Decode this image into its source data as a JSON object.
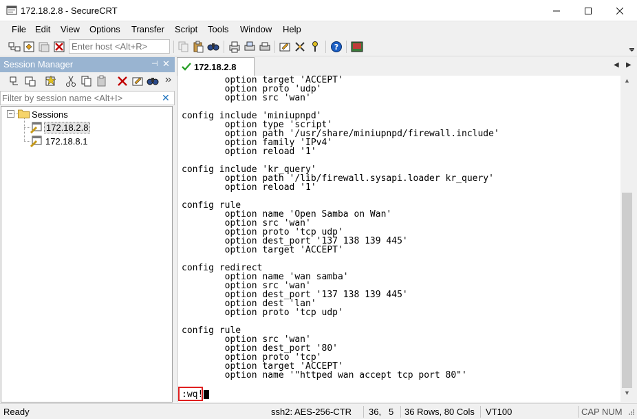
{
  "window": {
    "title": "172.18.2.8 - SecureCRT"
  },
  "menu": [
    "File",
    "Edit",
    "View",
    "Options",
    "Transfer",
    "Script",
    "Tools",
    "Window",
    "Help"
  ],
  "toolbar": {
    "host_placeholder": "Enter host <Alt+R>"
  },
  "session_manager": {
    "title": "Session Manager",
    "filter_placeholder": "Filter by session name <Alt+I>",
    "root": "Sessions",
    "sessions": [
      "172.18.2.8",
      "172.18.8.1"
    ]
  },
  "tabs": [
    {
      "label": "172.18.2.8"
    }
  ],
  "terminal": {
    "lines": [
      "        option target 'ACCEPT'",
      "        option proto 'udp'",
      "        option src 'wan'",
      "",
      "config include 'miniupnpd'",
      "        option type 'script'",
      "        option path '/usr/share/miniupnpd/firewall.include'",
      "        option family 'IPv4'",
      "        option reload '1'",
      "",
      "config include 'kr_query'",
      "        option path '/lib/firewall.sysapi.loader kr_query'",
      "        option reload '1'",
      "",
      "config rule",
      "        option name 'Open Samba on Wan'",
      "        option src 'wan'",
      "        option proto 'tcp udp'",
      "        option dest_port '137 138 139 445'",
      "        option target 'ACCEPT'",
      "",
      "config redirect",
      "        option name 'wan samba'",
      "        option src 'wan'",
      "        option dest_port '137 138 139 445'",
      "        option dest 'lan'",
      "        option proto 'tcp udp'",
      "",
      "config rule",
      "        option src 'wan'",
      "        option dest_port '80'",
      "        option proto 'tcp'",
      "        option target 'ACCEPT'",
      "        option name '\"httped wan accept tcp port 80\"'"
    ],
    "command": ":wq!"
  },
  "status": {
    "ready": "Ready",
    "cipher": "ssh2: AES-256-CTR",
    "row": "36,",
    "col": "5",
    "size": "36 Rows, 80 Cols",
    "emulation": "VT100",
    "caps": "CAP",
    "num": "NUM"
  },
  "colors": {
    "accent": "#99b4d1",
    "highlight": "#e02020"
  }
}
